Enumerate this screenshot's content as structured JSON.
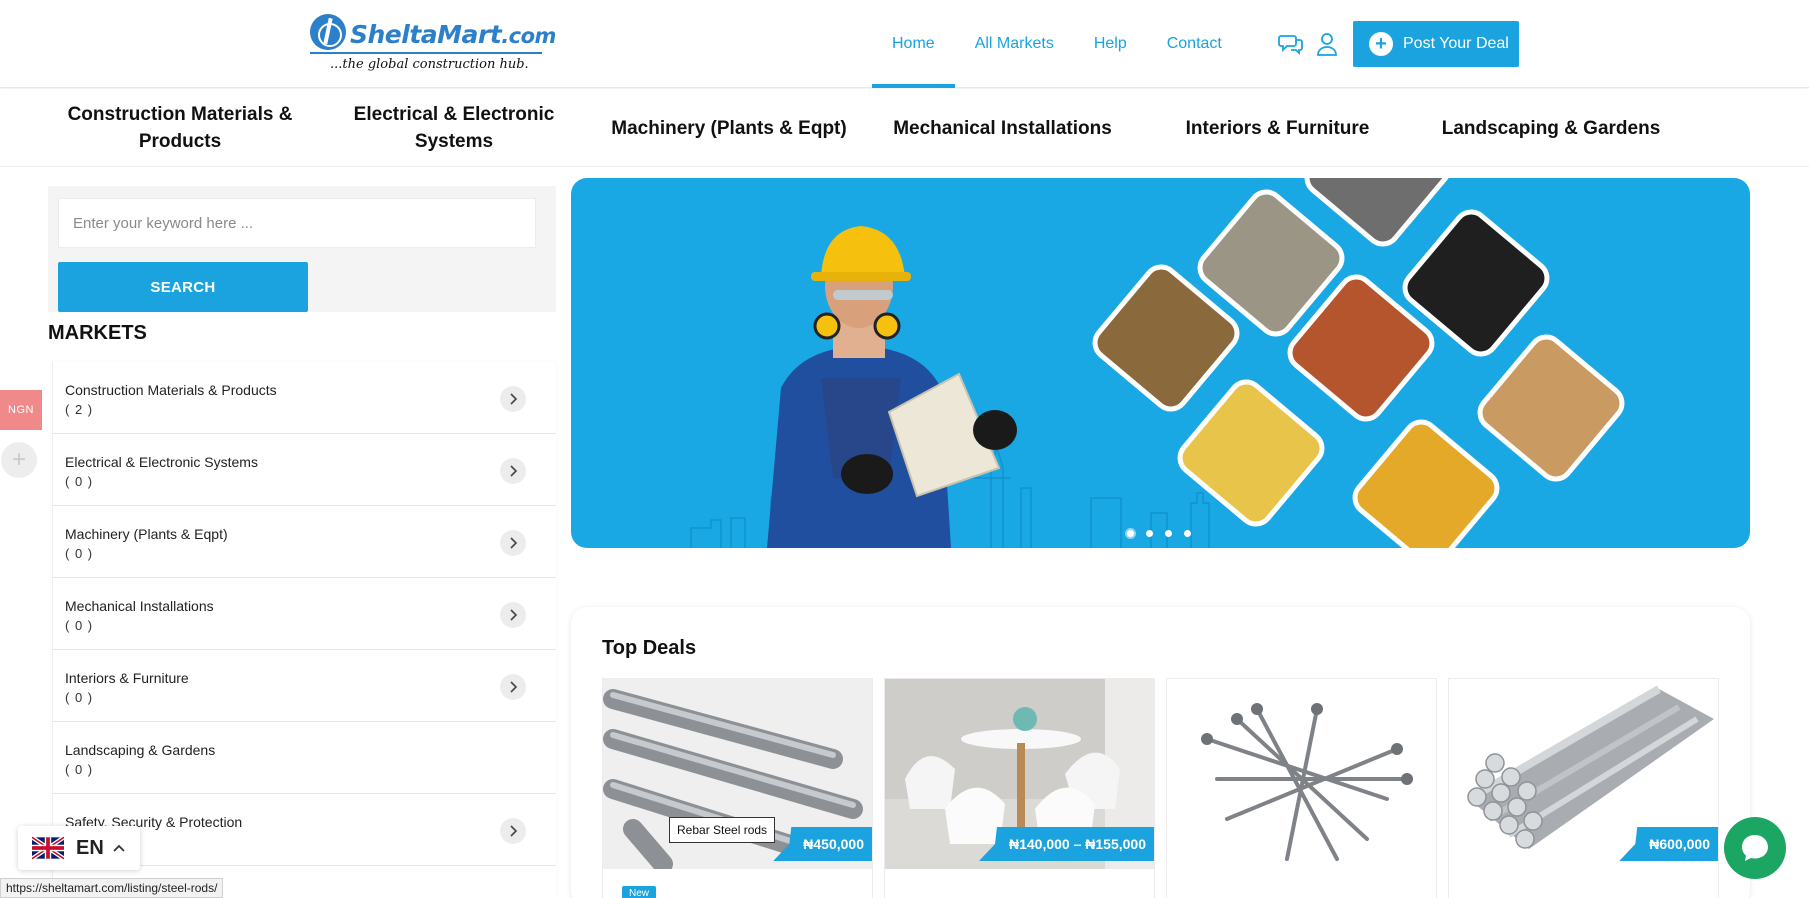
{
  "brand": {
    "name": "SheltaMart",
    "domain_suffix": ".com",
    "tagline": "...the global construction hub."
  },
  "nav": {
    "items": [
      "Home",
      "All Markets",
      "Help",
      "Contact"
    ],
    "active": "Home",
    "post_deal_label": "Post Your Deal"
  },
  "categories": [
    "Construction Materials & Products",
    "Electrical & Electronic Systems",
    "Machinery (Plants & Eqpt)",
    "Mechanical Installations",
    "Interiors & Furniture",
    "Landscaping & Gardens"
  ],
  "search": {
    "placeholder": "Enter your keyword here ...",
    "button_label": "SEARCH"
  },
  "markets": {
    "title": "MARKETS",
    "items": [
      {
        "name": "Construction Materials & Products",
        "count": "( 2 )"
      },
      {
        "name": "Electrical & Electronic Systems",
        "count": "( 0 )"
      },
      {
        "name": "Machinery (Plants & Eqpt)",
        "count": "( 0 )"
      },
      {
        "name": "Mechanical Installations",
        "count": "( 0 )"
      },
      {
        "name": "Interiors & Furniture",
        "count": "( 0 )"
      },
      {
        "name": "Landscaping & Gardens",
        "count": "( 0 )"
      },
      {
        "name": "Safety, Security & Protection",
        "count": ""
      }
    ]
  },
  "currency": "NGN",
  "top_deals": {
    "title": "Top Deals",
    "items": [
      {
        "price": "₦450,000",
        "tooltip": "Rebar Steel rods",
        "badge": "New"
      },
      {
        "price": "₦140,000 – ₦155,000"
      },
      {
        "price": ""
      },
      {
        "price": "₦600,000"
      }
    ]
  },
  "language": {
    "code": "EN"
  },
  "status_url": "https://sheltamart.com/listing/steel-rods/",
  "colors": {
    "accent": "#1aa3df",
    "banner": "#1aa8e4",
    "currency_tab": "#f08a8a",
    "chat": "#1ba664"
  }
}
